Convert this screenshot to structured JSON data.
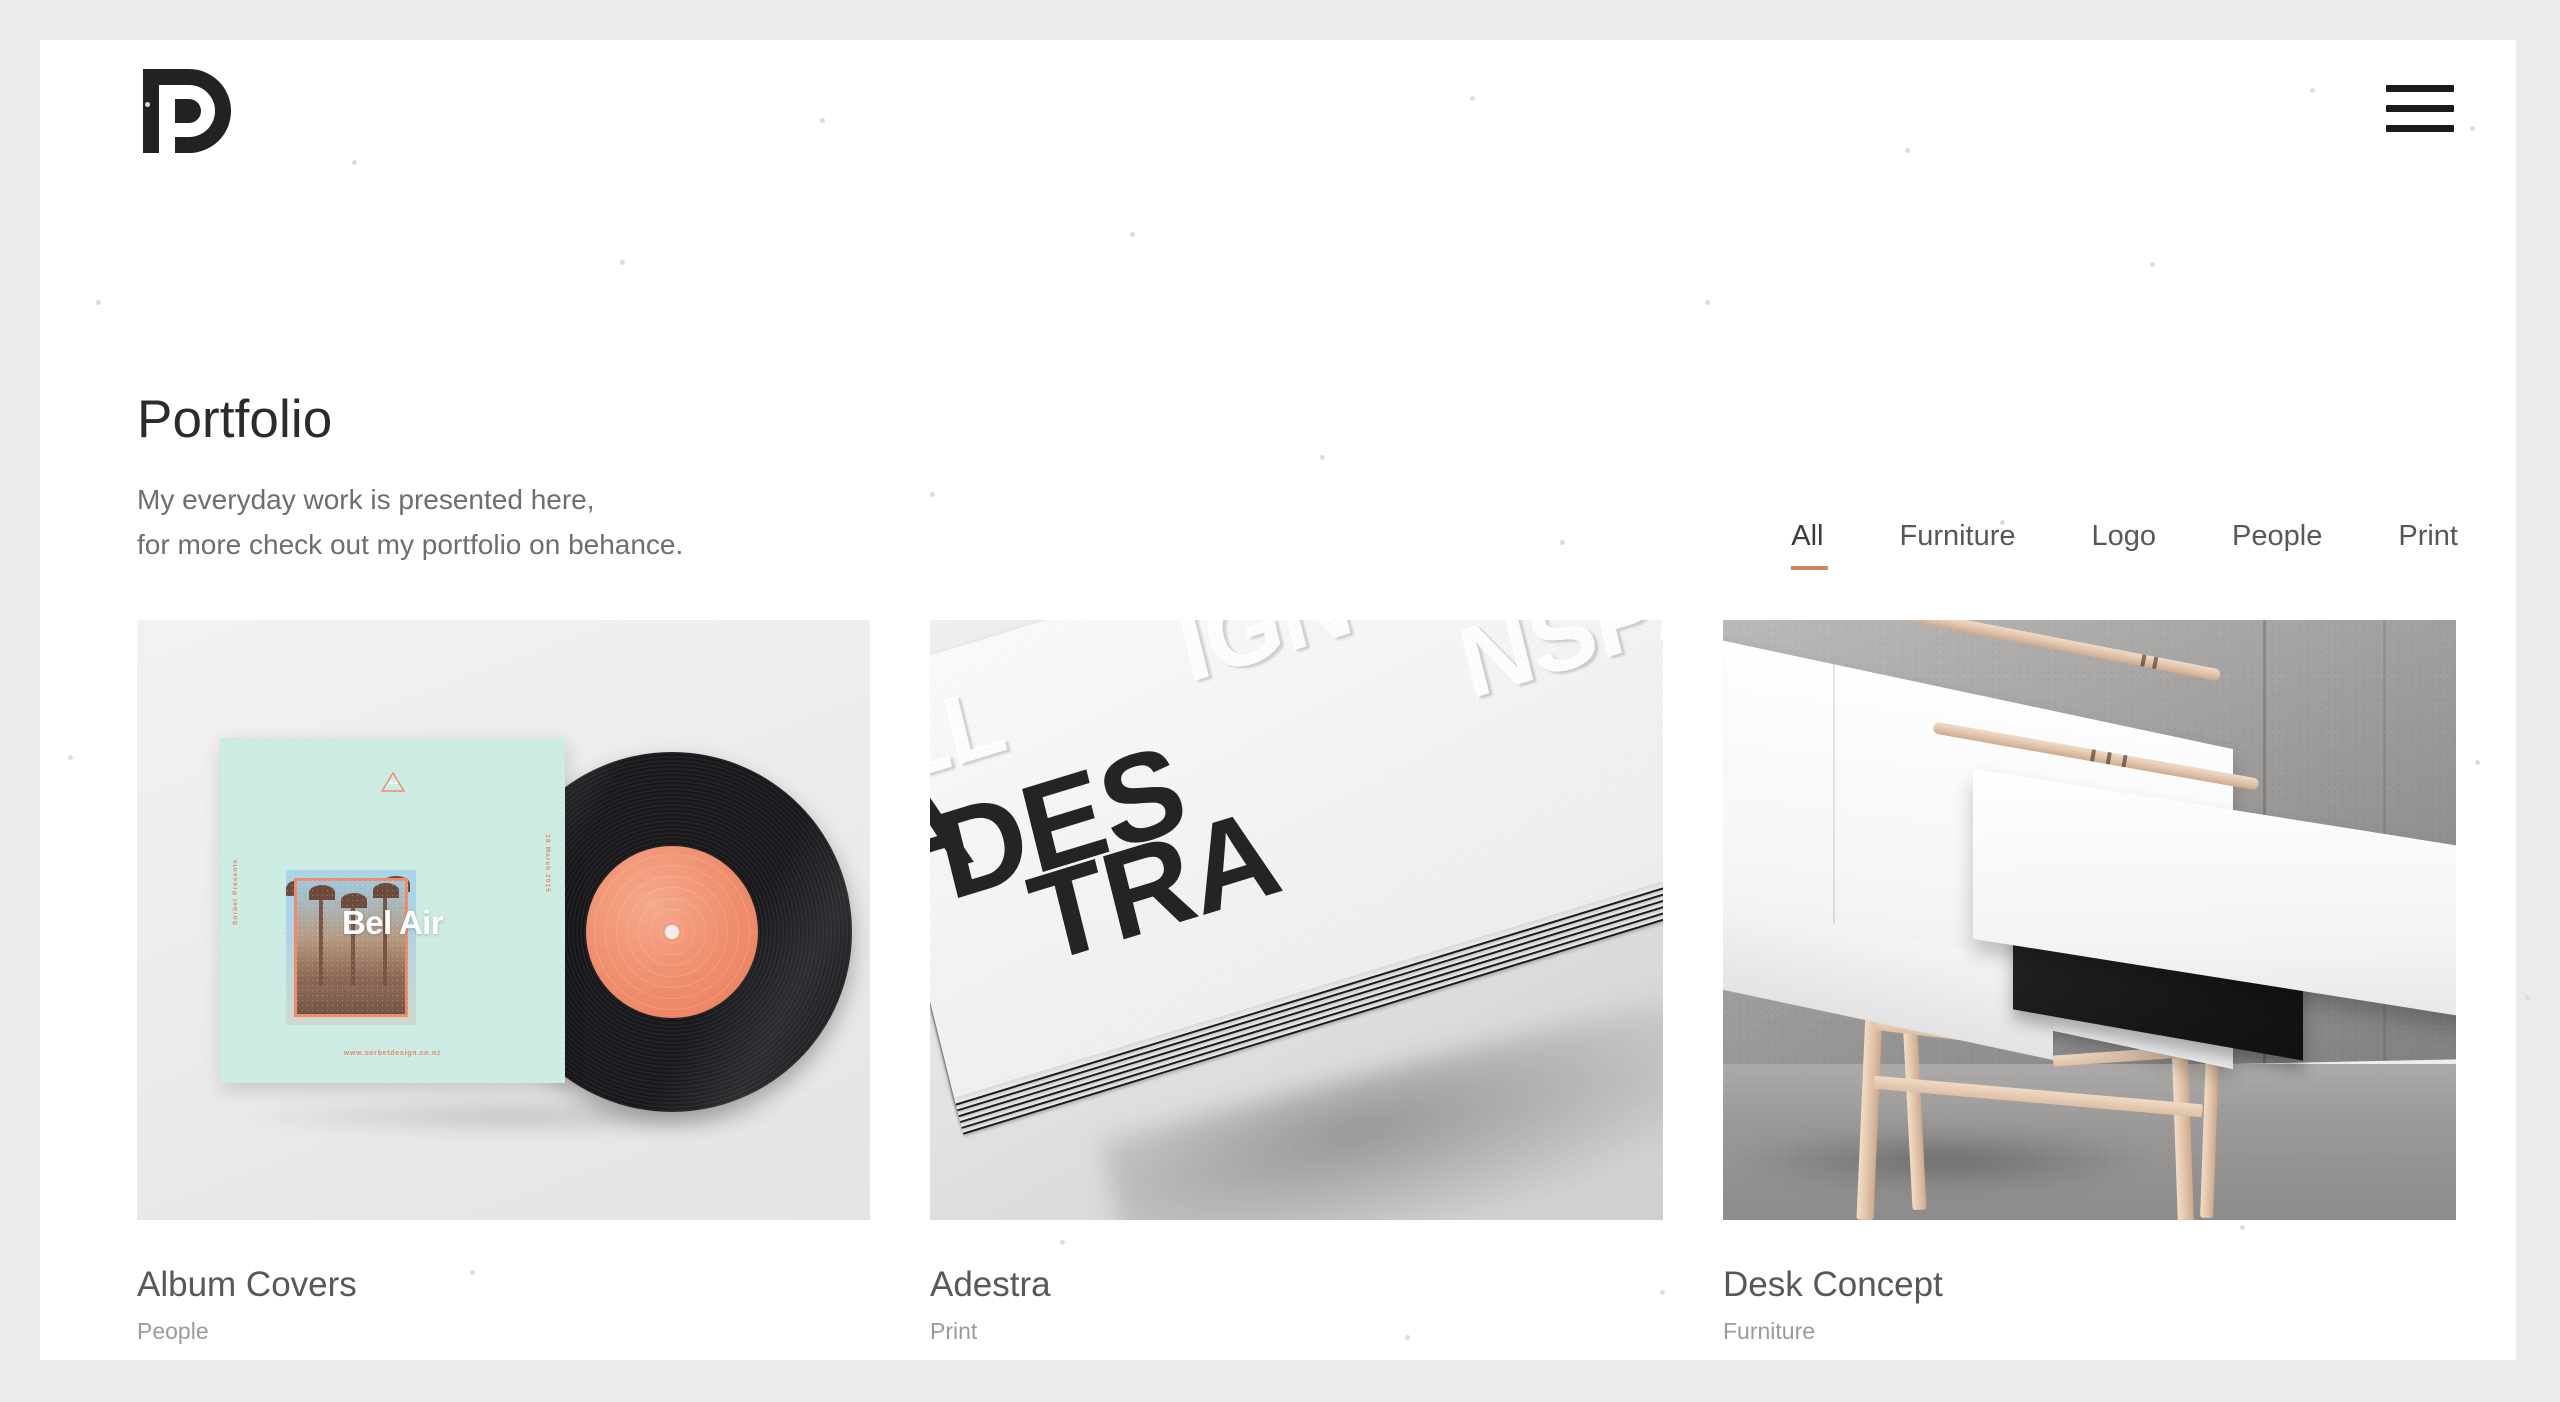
{
  "header": {
    "logo_alt": "P logo",
    "menu_label": "Menu"
  },
  "intro": {
    "title": "Portfolio",
    "line1": "My everyday work is presented here,",
    "line2": "for more check out my portfolio on behance."
  },
  "filters": {
    "active": "All",
    "accent_color": "#d4825c",
    "items": [
      {
        "label": "All"
      },
      {
        "label": "Furniture"
      },
      {
        "label": "Logo"
      },
      {
        "label": "People"
      },
      {
        "label": "Print"
      }
    ]
  },
  "projects": [
    {
      "title": "Album Covers",
      "category": "People",
      "artwork": {
        "kind": "album-cover-vinyl",
        "sleeve_title": "Bel Air",
        "sleeve_left_text": "Sorbet Presents",
        "sleeve_right_text": "18 March 2015",
        "sleeve_url": "www.sorbetdesign.co.nz",
        "sleeve_color": "#ccebe3",
        "accent_color": "#ef8a64",
        "record_label_color": "#ef8d6b"
      }
    },
    {
      "title": "Adestra",
      "category": "Print",
      "artwork": {
        "kind": "letterpress-card-stack",
        "inked_lines": [
          "A",
          "DES",
          "TRA"
        ],
        "embossed_lines": [
          "LL",
          "IGN",
          "NSPARE"
        ],
        "full_phrase": "ALL DESIGN TRANSPARENT",
        "ink_color": "#242427",
        "paper_color": "#f6f6f6"
      }
    },
    {
      "title": "Desk Concept",
      "category": "Furniture",
      "artwork": {
        "kind": "desk-photo",
        "desk_color": "#ffffff",
        "leg_color": "#e2c5ab",
        "drawer_color": "#161618",
        "wall_color": "#a09e9c"
      }
    }
  ],
  "theme": {
    "page_background": "#ebebeb",
    "panel_background": "#ffffff",
    "title_color": "#2b2b2d",
    "body_color": "#6e6e70",
    "muted_color": "#9b9b9d"
  }
}
